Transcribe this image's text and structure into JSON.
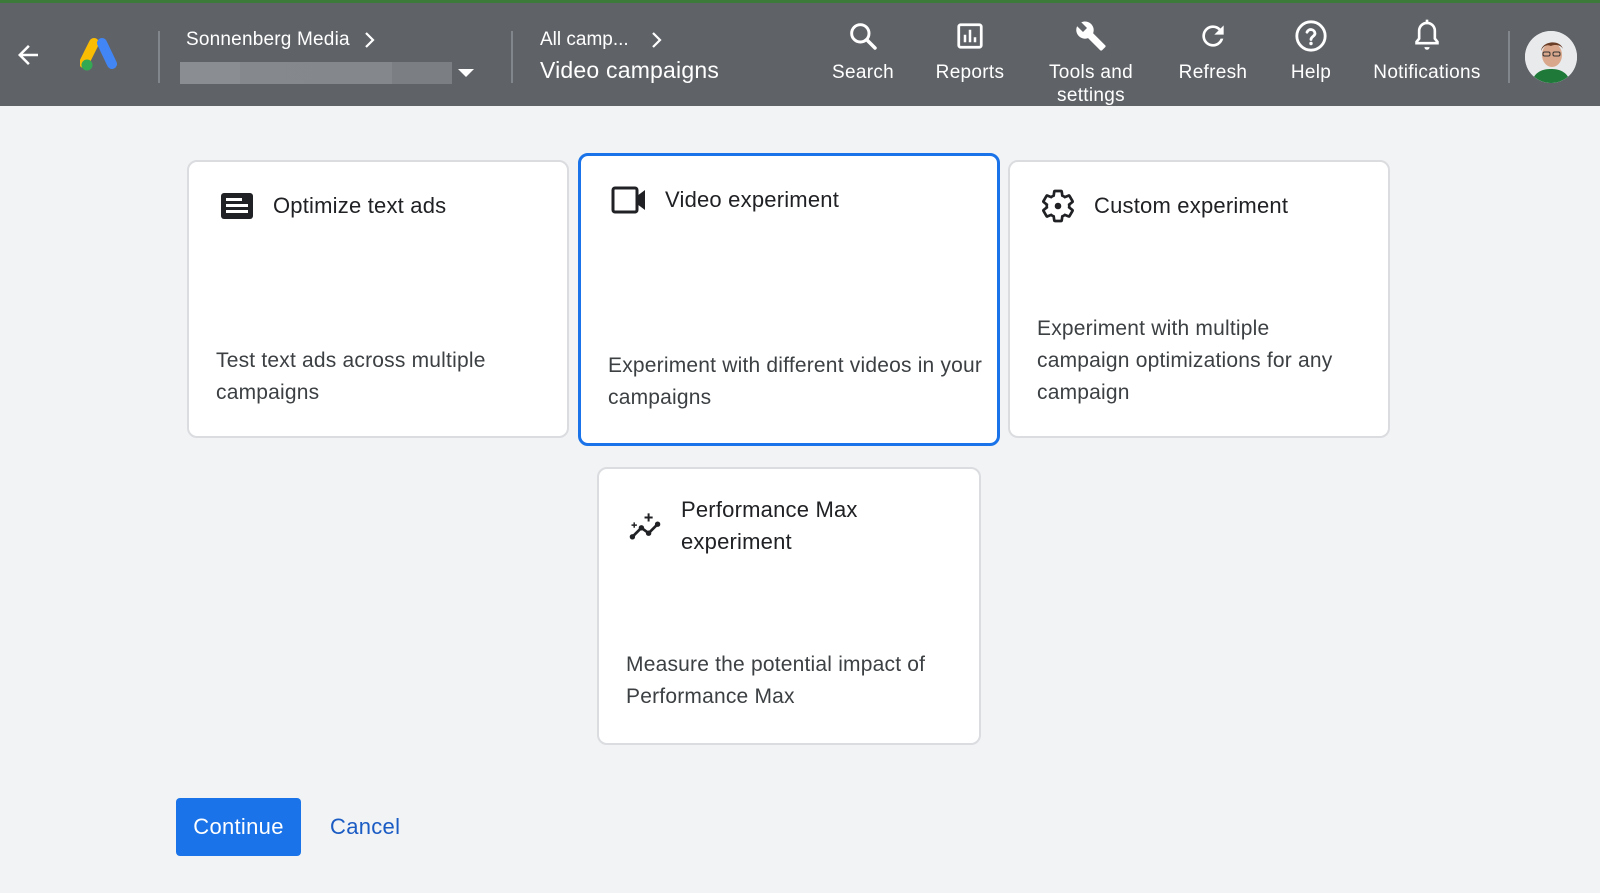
{
  "header": {
    "back_icon": "arrow-back-icon",
    "logo": "google-ads-logo",
    "account": {
      "name": "Sonnenberg Media",
      "chevron": "chevron-right-icon",
      "selector_value": "",
      "selector_icon": "caret-down-icon"
    },
    "breadcrumb": {
      "parent": "All camp...",
      "chevron": "chevron-right-icon",
      "title": "Video campaigns"
    },
    "nav": [
      {
        "label": "Search",
        "icon": "search-icon"
      },
      {
        "label": "Reports",
        "icon": "reports-icon"
      },
      {
        "label": "Tools and settings",
        "icon": "wrench-icon"
      },
      {
        "label": "Refresh",
        "icon": "refresh-icon"
      },
      {
        "label": "Help",
        "icon": "help-icon"
      },
      {
        "label": "Notifications",
        "icon": "bell-icon"
      }
    ],
    "avatar": "user-avatar"
  },
  "experiments": [
    {
      "title": "Optimize text ads",
      "description": "Test text ads across multiple campaigns",
      "icon": "text-ad-icon",
      "selected": false
    },
    {
      "title": "Video experiment",
      "description": "Experiment with different videos in your campaigns",
      "icon": "videocam-icon",
      "selected": true
    },
    {
      "title": "Custom experiment",
      "description": "Experiment with multiple campaign optimizations for any campaign",
      "icon": "gear-icon",
      "selected": false
    },
    {
      "title": "Performance Max experiment",
      "description": "Measure the potential impact of Performance Max",
      "icon": "sparkle-chart-icon",
      "selected": false
    }
  ],
  "actions": {
    "continue_label": "Continue",
    "cancel_label": "Cancel"
  },
  "colors": {
    "header_bg": "#5f6368",
    "page_bg": "#f1f3f4",
    "accent": "#1a73e8",
    "link": "#1a5bc4",
    "card_border": "#dadce0"
  }
}
